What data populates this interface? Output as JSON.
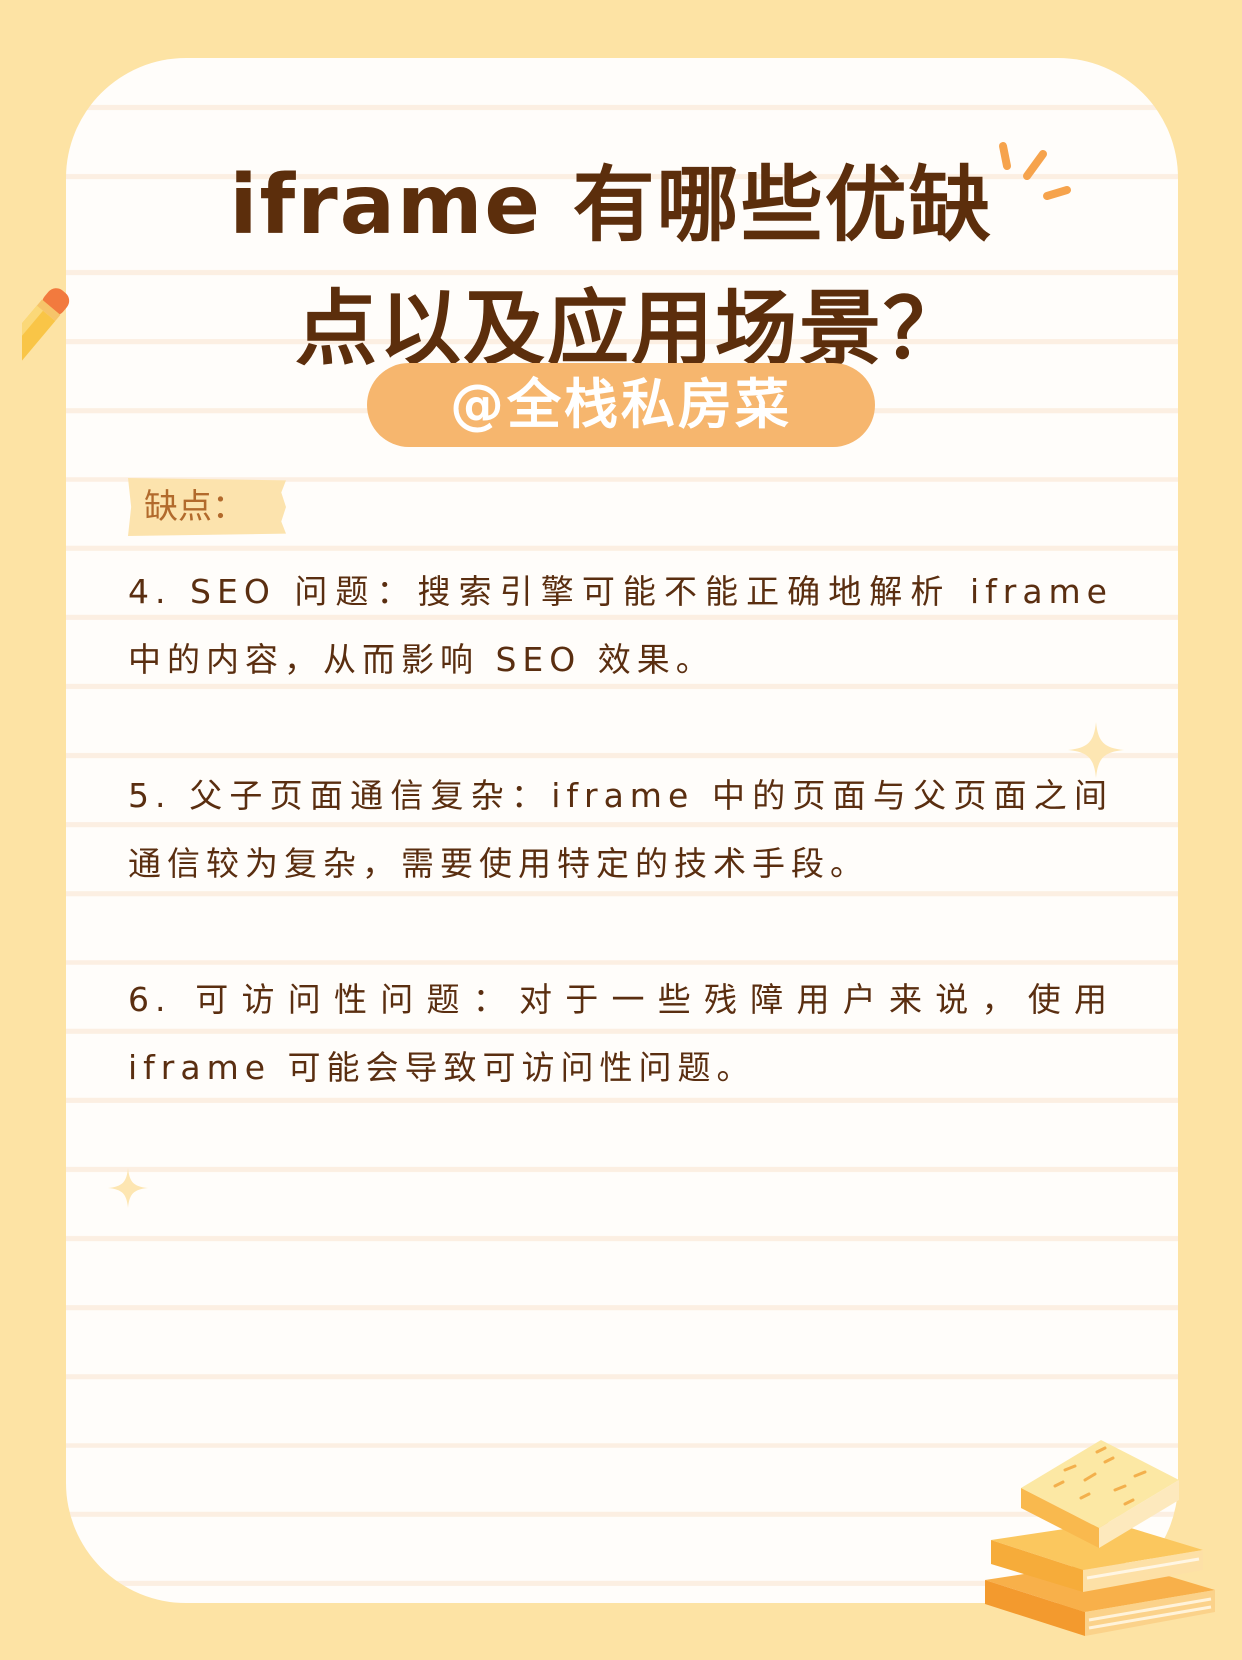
{
  "page": {
    "title_line1": "iframe 有哪些优缺",
    "title_line2": "点以及应用场景？",
    "author": "@全栈私房菜",
    "section_label": "缺点：",
    "items": [
      "4. SEO 问题：搜索引擎可能不能正确地解析 iframe 中的内容，从而影响 SEO 效果。",
      "5. 父子页面通信复杂：iframe 中的页面与父页面之间通信较为复杂，需要使用特定的技术手段。",
      "6. 可访问性问题：对于一些残障用户来说，使用 iframe 可能会导致可访问性问题。"
    ]
  },
  "colors": {
    "background": "#fde3a4",
    "card": "#fffdfa",
    "title": "#5c2e0c",
    "author_pill": "#f6b66e",
    "text": "#5a2e10",
    "accent": "#f3a24a"
  },
  "icons": [
    "pencil-icon",
    "burst-icon",
    "sparkle-icon",
    "books-icon"
  ]
}
